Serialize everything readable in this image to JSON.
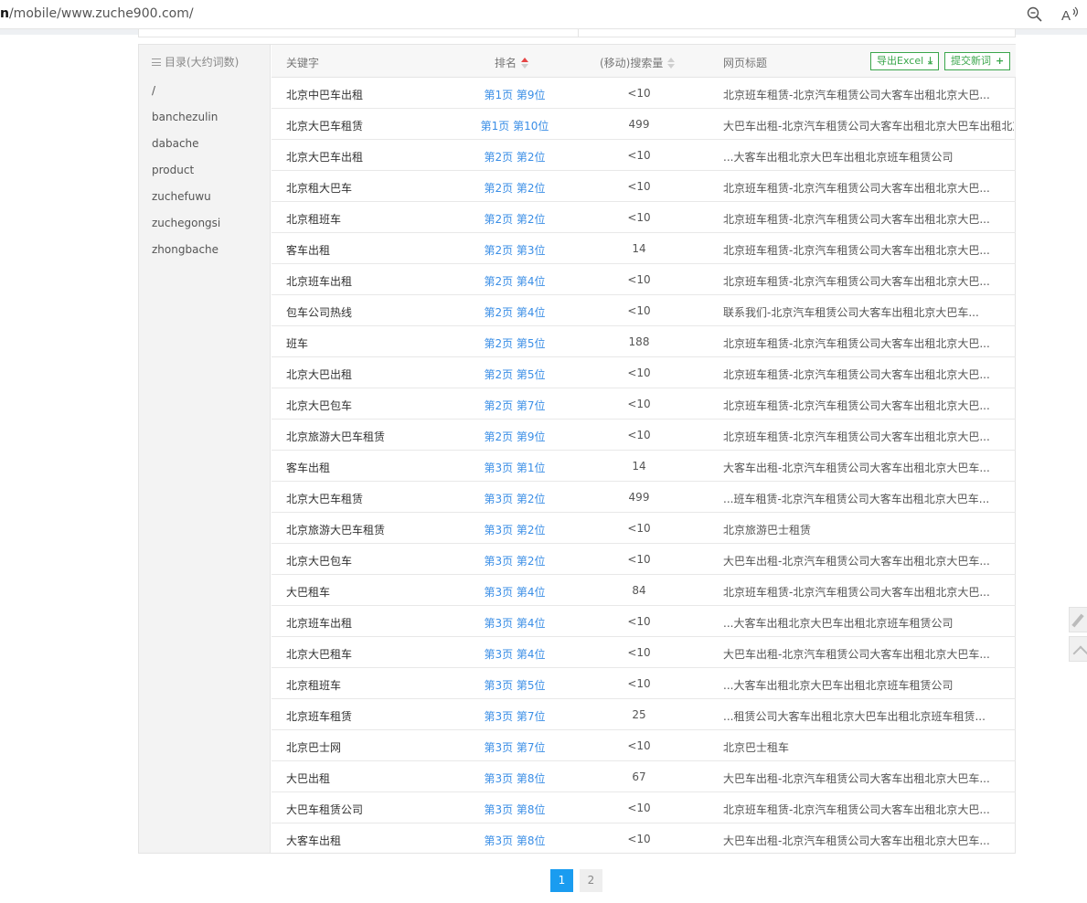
{
  "browser": {
    "url_host": "n",
    "url_path": "/mobile/www.zuche900.com/",
    "zoom_icon": "zoom-out-icon",
    "read_aloud_icon": "read-aloud-icon"
  },
  "sidebar": {
    "title": "目录(大约词数)",
    "items": [
      "/",
      "banchezulin",
      "dabache",
      "product",
      "zuchefuwu",
      "zuchegongsi",
      "zhongbache"
    ]
  },
  "table": {
    "headers": {
      "keyword": "关键字",
      "rank": "排名",
      "volume": "(移动)搜索量",
      "title": "网页标题"
    },
    "export_button": "导出Excel",
    "submit_button": "提交新词",
    "rows": [
      {
        "keyword": "北京中巴车出租",
        "rank": "第1页 第9位",
        "volume": "<10",
        "title": "北京班车租赁-北京汽车租赁公司大客车出租北京大巴..."
      },
      {
        "keyword": "北京大巴车租赁",
        "rank": "第1页 第10位",
        "volume": "499",
        "title": "大巴车出租-北京汽车租赁公司大客车出租北京大巴车出租北京..."
      },
      {
        "keyword": "北京大巴车出租",
        "rank": "第2页 第2位",
        "volume": "<10",
        "title": "...大客车出租北京大巴车出租北京班车租赁公司"
      },
      {
        "keyword": "北京租大巴车",
        "rank": "第2页 第2位",
        "volume": "<10",
        "title": "北京班车租赁-北京汽车租赁公司大客车出租北京大巴..."
      },
      {
        "keyword": "北京租班车",
        "rank": "第2页 第2位",
        "volume": "<10",
        "title": "北京班车租赁-北京汽车租赁公司大客车出租北京大巴..."
      },
      {
        "keyword": "客车出租",
        "rank": "第2页 第3位",
        "volume": "14",
        "title": "北京班车租赁-北京汽车租赁公司大客车出租北京大巴..."
      },
      {
        "keyword": "北京班车出租",
        "rank": "第2页 第4位",
        "volume": "<10",
        "title": "北京班车租赁-北京汽车租赁公司大客车出租北京大巴..."
      },
      {
        "keyword": "包车公司热线",
        "rank": "第2页 第4位",
        "volume": "<10",
        "title": "联系我们-北京汽车租赁公司大客车出租北京大巴车..."
      },
      {
        "keyword": "班车",
        "rank": "第2页 第5位",
        "volume": "188",
        "title": "北京班车租赁-北京汽车租赁公司大客车出租北京大巴..."
      },
      {
        "keyword": "北京大巴出租",
        "rank": "第2页 第5位",
        "volume": "<10",
        "title": "北京班车租赁-北京汽车租赁公司大客车出租北京大巴..."
      },
      {
        "keyword": "北京大巴包车",
        "rank": "第2页 第7位",
        "volume": "<10",
        "title": "北京班车租赁-北京汽车租赁公司大客车出租北京大巴..."
      },
      {
        "keyword": "北京旅游大巴车租赁",
        "rank": "第2页 第9位",
        "volume": "<10",
        "title": "北京班车租赁-北京汽车租赁公司大客车出租北京大巴..."
      },
      {
        "keyword": "客车出租",
        "rank": "第3页 第1位",
        "volume": "14",
        "title": "大客车出租-北京汽车租赁公司大客车出租北京大巴车..."
      },
      {
        "keyword": "北京大巴车租赁",
        "rank": "第3页 第2位",
        "volume": "499",
        "title": "...班车租赁-北京汽车租赁公司大客车出租北京大巴车..."
      },
      {
        "keyword": "北京旅游大巴车租赁",
        "rank": "第3页 第2位",
        "volume": "<10",
        "title": "北京旅游巴士租赁"
      },
      {
        "keyword": "北京大巴包车",
        "rank": "第3页 第2位",
        "volume": "<10",
        "title": "大巴车出租-北京汽车租赁公司大客车出租北京大巴车..."
      },
      {
        "keyword": "大巴租车",
        "rank": "第3页 第4位",
        "volume": "84",
        "title": "北京班车租赁-北京汽车租赁公司大客车出租北京大巴..."
      },
      {
        "keyword": "北京班车出租",
        "rank": "第3页 第4位",
        "volume": "<10",
        "title": "...大客车出租北京大巴车出租北京班车租赁公司"
      },
      {
        "keyword": "北京大巴租车",
        "rank": "第3页 第4位",
        "volume": "<10",
        "title": "大巴车出租-北京汽车租赁公司大客车出租北京大巴车..."
      },
      {
        "keyword": "北京租班车",
        "rank": "第3页 第5位",
        "volume": "<10",
        "title": "...大客车出租北京大巴车出租北京班车租赁公司"
      },
      {
        "keyword": "北京班车租赁",
        "rank": "第3页 第7位",
        "volume": "25",
        "title": "...租赁公司大客车出租北京大巴车出租北京班车租赁..."
      },
      {
        "keyword": "北京巴士网",
        "rank": "第3页 第7位",
        "volume": "<10",
        "title": "北京巴士租车"
      },
      {
        "keyword": "大巴出租",
        "rank": "第3页 第8位",
        "volume": "67",
        "title": "大巴车出租-北京汽车租赁公司大客车出租北京大巴车..."
      },
      {
        "keyword": "大巴车租赁公司",
        "rank": "第3页 第8位",
        "volume": "<10",
        "title": "北京班车租赁-北京汽车租赁公司大客车出租北京大巴..."
      },
      {
        "keyword": "大客车出租",
        "rank": "第3页 第8位",
        "volume": "<10",
        "title": "大巴车出租-北京汽车租赁公司大客车出租北京大巴车..."
      }
    ]
  },
  "pagination": {
    "current": "1",
    "next": "2"
  },
  "colors": {
    "link": "#3a8ee6",
    "accent_green": "#3aa64b",
    "active_page": "#1a9cf0",
    "sort_active": "#e64545"
  }
}
